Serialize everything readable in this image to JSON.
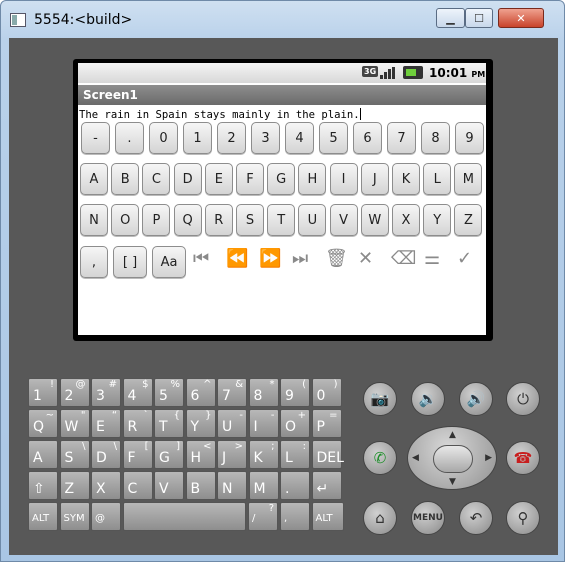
{
  "window": {
    "title": "5554:<build>",
    "min_label": "▁",
    "max_label": "☐",
    "close_label": "✕"
  },
  "status": {
    "network": "3G",
    "time": "10:01",
    "ampm": "PM"
  },
  "app": {
    "title": "Screen1",
    "text": "The rain in Spain stays mainly in the plain."
  },
  "onscreen_keyboard": {
    "row1": [
      "-",
      ".",
      "0",
      "1",
      "2",
      "3",
      "4",
      "5",
      "6",
      "7",
      "8",
      "9"
    ],
    "row2": [
      "A",
      "B",
      "C",
      "D",
      "E",
      "F",
      "G",
      "H",
      "I",
      "J",
      "K",
      "L",
      "M"
    ],
    "row3": [
      "N",
      "O",
      "P",
      "Q",
      "R",
      "S",
      "T",
      "U",
      "V",
      "W",
      "X",
      "Y",
      "Z"
    ],
    "row4": [
      ",",
      "[ ]",
      "Aa"
    ],
    "tool_icons": [
      {
        "name": "skip-to-start-icon",
        "glyph": "⏮"
      },
      {
        "name": "rewind-icon",
        "glyph": "⏪"
      },
      {
        "name": "fast-forward-icon",
        "glyph": "⏩"
      },
      {
        "name": "skip-to-end-icon",
        "glyph": "⏭"
      },
      {
        "name": "trash-icon",
        "glyph": "🗑"
      },
      {
        "name": "close-icon",
        "glyph": "✕"
      },
      {
        "name": "backspace-icon",
        "glyph": "⌫"
      },
      {
        "name": "settings-sliders-icon",
        "glyph": "⚌"
      },
      {
        "name": "checkmark-icon",
        "glyph": "✓"
      }
    ]
  },
  "hardware_keyboard": {
    "rows": [
      [
        [
          "1",
          "!"
        ],
        [
          "2",
          "@"
        ],
        [
          "3",
          "#"
        ],
        [
          "4",
          "$"
        ],
        [
          "5",
          "%"
        ],
        [
          "6",
          "^"
        ],
        [
          "7",
          "&"
        ],
        [
          "8",
          "*"
        ],
        [
          "9",
          "("
        ],
        [
          "0",
          ")"
        ]
      ],
      [
        [
          "Q",
          "~"
        ],
        [
          "W",
          "\""
        ],
        [
          "E",
          "“"
        ],
        [
          "R",
          "`"
        ],
        [
          "T",
          "{"
        ],
        [
          "Y",
          "}"
        ],
        [
          "U",
          "-"
        ],
        [
          "I",
          "-"
        ],
        [
          "O",
          "+"
        ],
        [
          "P",
          "="
        ]
      ],
      [
        [
          "A",
          ""
        ],
        [
          "S",
          "\\"
        ],
        [
          "D",
          "\\"
        ],
        [
          "F",
          "["
        ],
        [
          "G",
          "]"
        ],
        [
          "H",
          "<"
        ],
        [
          "J",
          ">"
        ],
        [
          "K",
          ";"
        ],
        [
          "L",
          ":"
        ],
        [
          "DEL",
          ""
        ]
      ],
      [
        [
          "⇧",
          ""
        ],
        [
          "Z",
          ""
        ],
        [
          "X",
          ""
        ],
        [
          "C",
          ""
        ],
        [
          "V",
          ""
        ],
        [
          "B",
          ""
        ],
        [
          "N",
          ""
        ],
        [
          "M",
          ""
        ],
        [
          ".",
          ""
        ],
        [
          "↵",
          ""
        ]
      ]
    ],
    "bottom": [
      [
        "ALT",
        ""
      ],
      [
        "SYM",
        ""
      ],
      [
        "@",
        ""
      ],
      [
        "",
        ""
      ],
      [
        "/",
        "?"
      ],
      [
        ",",
        ""
      ],
      [
        "ALT",
        ""
      ]
    ]
  },
  "hardware_buttons": {
    "camera": "camera-icon",
    "vol_down": "volume-down-icon",
    "vol_up": "volume-up-icon",
    "power": "power-icon",
    "call": "call-icon",
    "end_call": "end-call-icon",
    "home": "home-icon",
    "menu_label": "MENU",
    "back": "back-icon",
    "search": "search-icon"
  }
}
